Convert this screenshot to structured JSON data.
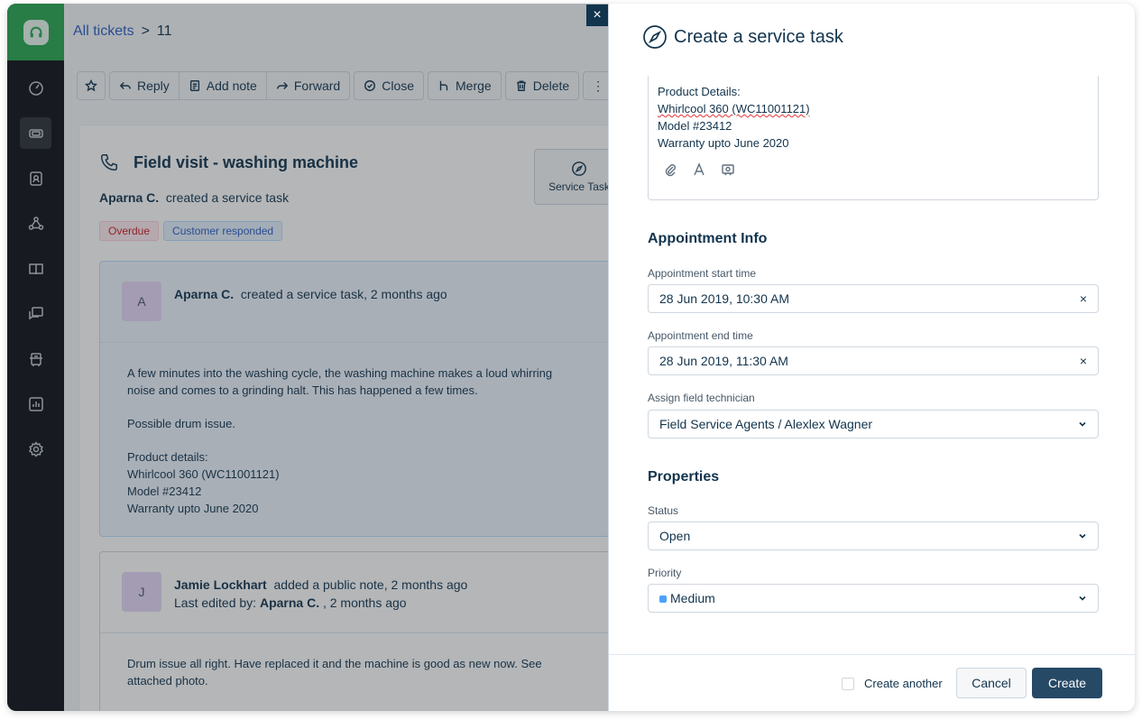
{
  "breadcrumb": {
    "all_tickets": "All tickets",
    "separator": ">",
    "ticket_id": "11"
  },
  "toolbar": {
    "reply": "Reply",
    "add_note": "Add note",
    "forward": "Forward",
    "close": "Close",
    "merge": "Merge",
    "delete": "Delete",
    "more": "⋮"
  },
  "ticket": {
    "title": "Field visit - washing machine",
    "creator": "Aparna C.",
    "created_text": "created a service task",
    "tags": {
      "overdue": "Overdue",
      "responded": "Customer responded"
    },
    "service_task_label": "Service Task",
    "conversations": [
      {
        "avatar": "A",
        "author": "Aparna C.",
        "meta": "created a service task, 2 months ago",
        "body": [
          "A few minutes into the washing cycle, the washing machine makes a loud whirring",
          "noise and comes to a grinding halt. This has happened a few times.",
          "",
          "Possible drum issue.",
          "",
          "Product details:",
          "Whirlcool 360 (WC11001121)",
          "Model #23412",
          "Warranty upto June 2020"
        ]
      },
      {
        "avatar": "J",
        "author": "Jamie Lockhart",
        "meta": "added a public note, 2 months ago",
        "edited_label": "Last edited by:",
        "editor": "Aparna C.",
        "edited_time": ", 2 months ago",
        "body": [
          "Drum issue all right. Have replaced it and the machine is good as new now. See",
          "attached photo."
        ]
      }
    ]
  },
  "panel": {
    "title": "Create a service task",
    "description": [
      "Product Details:",
      "Whirlcool 360 (WC11001121)",
      "Model #23412",
      "Warranty upto June 2020"
    ],
    "appointment": {
      "section_title": "Appointment Info",
      "start_label": "Appointment start time",
      "start_value": "28 Jun 2019, 10:30 AM",
      "end_label": "Appointment end time",
      "end_value": "28 Jun 2019, 11:30 AM",
      "tech_label": "Assign field technician",
      "tech_value": "Field Service Agents / Alexlex Wagner"
    },
    "properties": {
      "section_title": "Properties",
      "status_label": "Status",
      "status_value": "Open",
      "priority_label": "Priority",
      "priority_value": "Medium"
    },
    "footer": {
      "create_another": "Create another",
      "cancel": "Cancel",
      "create": "Create"
    }
  },
  "colors": {
    "brand": "#27a84f",
    "primary_button": "#264966",
    "sidebar": "#0f1217"
  },
  "icons": [
    "headset-logo-icon",
    "dashboard-icon",
    "tickets-icon",
    "contacts-icon",
    "social-icon",
    "solutions-icon",
    "forums-icon",
    "service-icon",
    "reports-icon",
    "settings-icon",
    "star-icon",
    "reply-icon",
    "note-icon",
    "forward-icon",
    "close-check-icon",
    "merge-icon",
    "trash-icon",
    "phone-icon",
    "compass-icon",
    "attach-icon",
    "text-format-icon",
    "canned-icon",
    "chevron-down-icon"
  ]
}
